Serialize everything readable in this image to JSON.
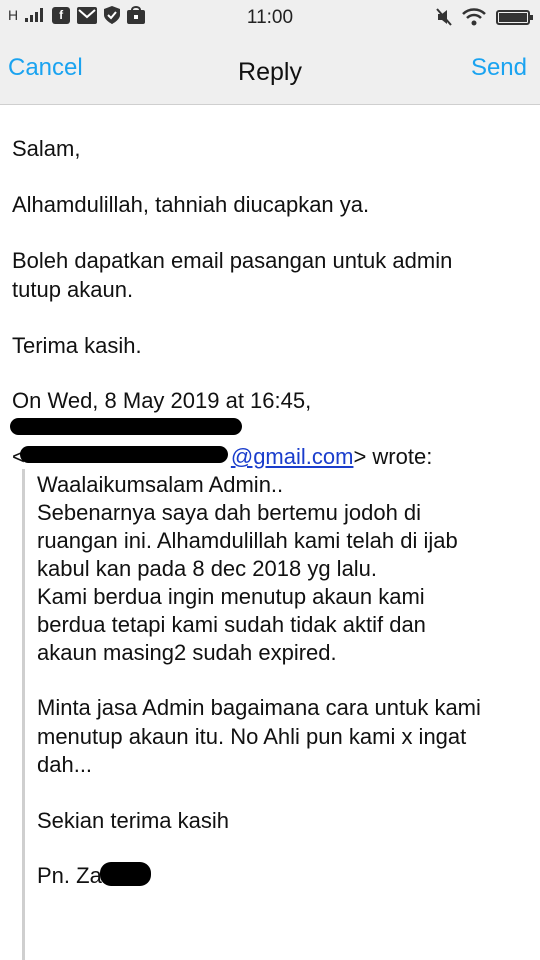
{
  "status_bar": {
    "network_label": "H",
    "time": "11:00",
    "left_icons": [
      "signal-icon",
      "facebook-icon",
      "mail-icon",
      "shield-icon",
      "store-icon"
    ],
    "right_icons": [
      "mute-icon",
      "wifi-icon",
      "battery-icon"
    ]
  },
  "nav": {
    "cancel": "Cancel",
    "title": "Reply",
    "send": "Send",
    "accent_color": "#1aa3f0"
  },
  "reply": {
    "greeting": "Salam,",
    "line1": "Alhamdulillah, tahniah diucapkan ya.",
    "line2a": "Boleh dapatkan email pasangan untuk admin",
    "line2b": "tutup akaun.",
    "thanks": "Terima kasih."
  },
  "attribution": {
    "date_line": "On Wed, 8 May 2019 at 16:45,",
    "email_prefix": "<",
    "email_domain": "@gmail.com",
    "wrote": "> wrote:"
  },
  "quoted": {
    "l1": "Waalaikumsalam Admin..",
    "l2": "Sebenarnya saya dah bertemu jodoh di",
    "l3": "ruangan ini. Alhamdulillah kami telah di ijab",
    "l4": "kabul kan pada 8 dec 2018 yg lalu.",
    "l5": "Kami berdua ingin menutup akaun kami",
    "l6": "berdua tetapi kami sudah tidak aktif dan",
    "l7": "akaun masing2 sudah expired.",
    "l8": "Minta jasa Admin bagaimana cara untuk kami",
    "l9": "menutup akaun itu. No Ahli pun kami x ingat",
    "l10": "dah...",
    "l11": "Sekian terima kasih",
    "l12": "Pn. Za"
  }
}
